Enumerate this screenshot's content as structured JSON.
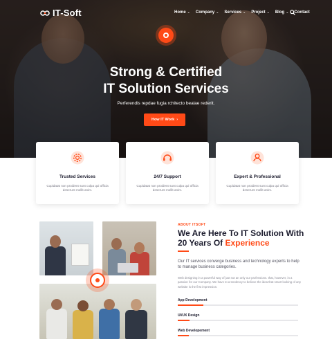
{
  "brand": {
    "name": "IT-Soft",
    "accent": "#ff4a17"
  },
  "nav": {
    "items": [
      {
        "label": "Home",
        "dropdown": true
      },
      {
        "label": "Company",
        "dropdown": true
      },
      {
        "label": "Services",
        "dropdown": true
      },
      {
        "label": "Project",
        "dropdown": true
      },
      {
        "label": "Blog",
        "dropdown": true
      },
      {
        "label": "Contact",
        "dropdown": false
      }
    ],
    "caret": "⌄"
  },
  "hero": {
    "title_line1": "Strong & Certified",
    "title_line2": "IT Solution Services",
    "subtitle": "Perferendis repdae fugia rchitecto bealae rederit.",
    "cta_label": "How IT Work",
    "cta_arrow": "›"
  },
  "features": [
    {
      "icon": "cog-icon",
      "title": "Trusted Services",
      "desc": "Cupidatat non proident sunt culpa qui officia deserunt mollit anim."
    },
    {
      "icon": "support-icon",
      "title": "24/7 Support",
      "desc": "Cupidatat non proident sunt culpa qui officia deserunt mollit anim."
    },
    {
      "icon": "expert-icon",
      "title": "Expert & Professional",
      "desc": "Cupidatat non proident sunt culpa qui officia deserunt mollit anim."
    }
  ],
  "about": {
    "eyebrow": "ABOUT ITSOFT",
    "title_line1": "We Are Here To IT Solution With",
    "title_line2_prefix": "20 Years Of ",
    "title_highlight": "Experience",
    "lead": "Our IT services converge business and technology experts to help to manage business categories.",
    "body": "Web designing in a powerful way of just not an only our professions. that, however, in a passion for our Company. We have to a tendency to believe the idea that smart looking of any website is the first impression.",
    "skills": [
      {
        "label": "App Development",
        "level": 0.21
      },
      {
        "label": "UI/UX Design",
        "level": 0.1
      },
      {
        "label": "Web Developement",
        "level": 0.09
      }
    ]
  }
}
